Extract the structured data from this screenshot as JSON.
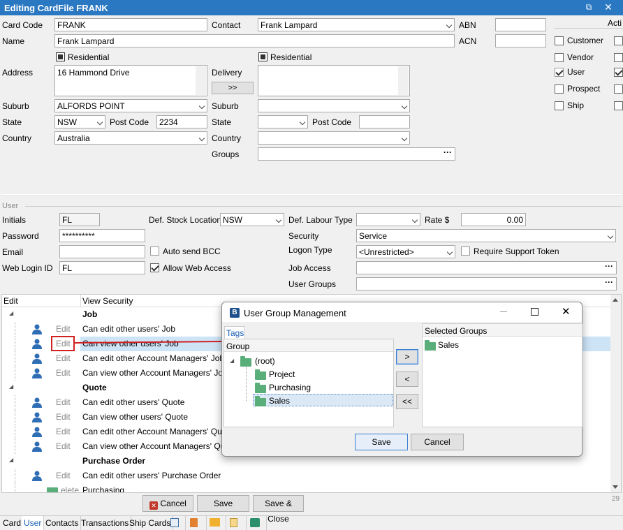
{
  "window": {
    "title": "Editing CardFile FRANK",
    "page_num": "29"
  },
  "card": {
    "card_code_label": "Card Code",
    "card_code": "FRANK",
    "contact_label": "Contact",
    "contact": "Frank Lampard",
    "abn_label": "ABN",
    "acn_label": "ACN",
    "name_label": "Name",
    "name": "Frank Lampard",
    "residential_label": "Residential",
    "residential2_label": "Residential",
    "address_label": "Address",
    "address": "16 Hammond Drive",
    "delivery_label": "Delivery",
    "copy_btn": ">>",
    "suburb_label": "Suburb",
    "suburb": "ALFORDS POINT",
    "suburb2_label": "Suburb",
    "state_label": "State",
    "state": "NSW",
    "postcode_label": "Post Code",
    "postcode": "2234",
    "state2_label": "State",
    "postcode2_label": "Post Code",
    "country_label": "Country",
    "country": "Australia",
    "country2_label": "Country",
    "groups_label": "Groups"
  },
  "roles": {
    "header": "Acti",
    "items": [
      {
        "label": "Customer",
        "checked": false
      },
      {
        "label": "Vendor",
        "checked": false
      },
      {
        "label": "User",
        "checked": true
      },
      {
        "label": "Prospect",
        "checked": false
      },
      {
        "label": "Ship",
        "checked": false
      }
    ]
  },
  "user": {
    "section": "User",
    "initials_label": "Initials",
    "initials": "FL",
    "def_stock_label": "Def. Stock Location",
    "def_stock": "NSW",
    "def_labour_label": "Def. Labour Type",
    "rate_label": "Rate $",
    "rate": "0.00",
    "password_label": "Password",
    "password": "**********",
    "security_label": "Security",
    "security": "Service",
    "email_label": "Email",
    "auto_bcc_label": "Auto send BCC",
    "logon_type_label": "Logon Type",
    "logon_type": "<Unrestricted>",
    "require_token_label": "Require Support Token",
    "web_login_label": "Web Login ID",
    "web_login": "FL",
    "allow_web_label": "Allow Web Access",
    "job_access_label": "Job Access",
    "user_groups_label": "User Groups"
  },
  "grid": {
    "col_edit": "Edit",
    "col_view": "View Security",
    "rows": [
      {
        "type": "group",
        "text": "Job"
      },
      {
        "type": "item",
        "edit": "Edit",
        "text": "Can edit other users' Job"
      },
      {
        "type": "item",
        "edit": "Edit",
        "text": "Can view other users' Job",
        "highlight": true
      },
      {
        "type": "item",
        "edit": "Edit",
        "text": "Can edit other Account Managers' Job"
      },
      {
        "type": "item",
        "edit": "Edit",
        "text": "Can view other Account Managers' Job"
      },
      {
        "type": "group",
        "text": "Quote"
      },
      {
        "type": "item",
        "edit": "Edit",
        "text": "Can edit other users' Quote"
      },
      {
        "type": "item",
        "edit": "Edit",
        "text": "Can view other users' Quote"
      },
      {
        "type": "item",
        "edit": "Edit",
        "text": "Can edit other Account Managers' Quote"
      },
      {
        "type": "item",
        "edit": "Edit",
        "text": "Can view other Account Managers' Quote"
      },
      {
        "type": "group",
        "text": "Purchase Order"
      },
      {
        "type": "item",
        "edit": "Edit",
        "text": "Can edit other users' Purchase Order"
      },
      {
        "type": "sub",
        "edit": "elete",
        "text": "Purchasing"
      }
    ]
  },
  "buttons": {
    "cancel": "Cancel",
    "save": "Save",
    "save_close": "Save & Close"
  },
  "tabs": [
    "Card",
    "User",
    "Contacts",
    "Transactions",
    "Ship Cards"
  ],
  "dialog": {
    "title": "User Group Management",
    "tab": "Tags",
    "group_header": "Group",
    "tree": [
      "(root)",
      "Project",
      "Purchasing",
      "Sales"
    ],
    "selected_header": "Selected Groups",
    "selected": [
      "Sales"
    ],
    "btn_add": ">",
    "btn_remove": "<",
    "btn_remove_all": "<<",
    "save": "Save",
    "cancel": "Cancel"
  }
}
